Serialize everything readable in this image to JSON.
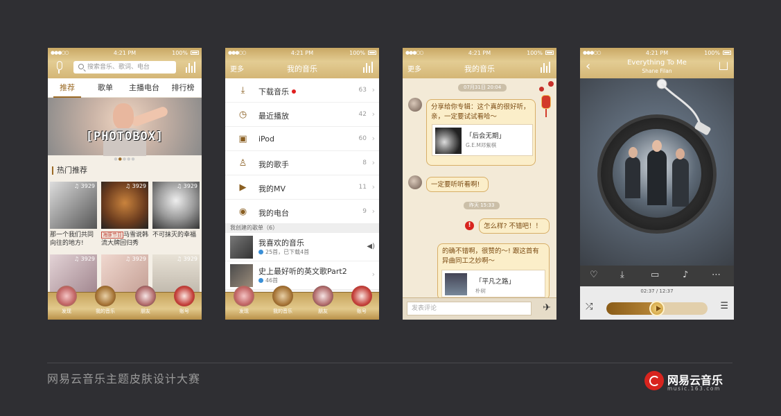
{
  "status": {
    "time": "4:21 PM",
    "battery": "100%"
  },
  "phone1": {
    "search_placeholder": "搜索音乐、歌词、电台",
    "tabs": [
      "推荐",
      "歌单",
      "主播电台",
      "排行榜"
    ],
    "banner_text": "[PHOTOBOX]",
    "section_title": "热门推荐",
    "tiles": [
      {
        "count": "3929",
        "caption": "那一个我们共同向往的地方!"
      },
      {
        "count": "3929",
        "tag": "海豚节目",
        "caption": "马雪说韩流大牌回归秀"
      },
      {
        "count": "3929",
        "caption": "不可抹灭的幸福"
      },
      {
        "count": "3929"
      },
      {
        "count": "3929"
      },
      {
        "count": "3929"
      }
    ]
  },
  "dock": {
    "items": [
      "发现",
      "我的音乐",
      "朋友",
      "账号"
    ]
  },
  "phone2": {
    "left": "更多",
    "title": "我的音乐",
    "rows": [
      {
        "label": "下载音乐",
        "count": "63",
        "dot": true
      },
      {
        "label": "最近播放",
        "count": "42"
      },
      {
        "label": "iPod",
        "count": "60"
      },
      {
        "label": "我的歌手",
        "count": "8"
      },
      {
        "label": "我的MV",
        "count": "11"
      },
      {
        "label": "我的电台",
        "count": "9"
      }
    ],
    "created_header": "我创建的歌单（6）",
    "playlists": [
      {
        "title": "我喜欢的音乐",
        "sub": "25首，已下载4首"
      },
      {
        "title": "史上最好听的英文歌Part2",
        "sub": "46首"
      }
    ]
  },
  "phone3": {
    "left": "更多",
    "title": "我的音乐",
    "stamp1": "07月31日 20:04",
    "msg1": "分享给你专辑：这个真的很好听，亲，一定要试试看哈～",
    "card1": {
      "title": "「后会无期」",
      "sub": "G.E.M邓紫棋"
    },
    "msg2": "一定要听听看啊!",
    "stamp2": "昨天 15:33",
    "msg3": "怎么样? 不错吧！！",
    "msg4": "的确不错啊，很赞的～! 跟这首有异曲同工之妙啊～",
    "card2": {
      "title": "「平凡之路」",
      "sub": "朴树"
    },
    "input_placeholder": "发表评论"
  },
  "phone4": {
    "song": "Everything To Me",
    "artist": "Shane Filan",
    "time": "02:37 / 12:37",
    "progress": 0.5
  },
  "footer": {
    "title": "网易云音乐主题皮肤设计大赛",
    "brand": "网易云音乐",
    "brand_url": "music.163.com"
  },
  "colors": {
    "accent": "#9b6a25",
    "bg": "#2f2f33",
    "gold": "#d4b676",
    "red": "#d8241e"
  }
}
